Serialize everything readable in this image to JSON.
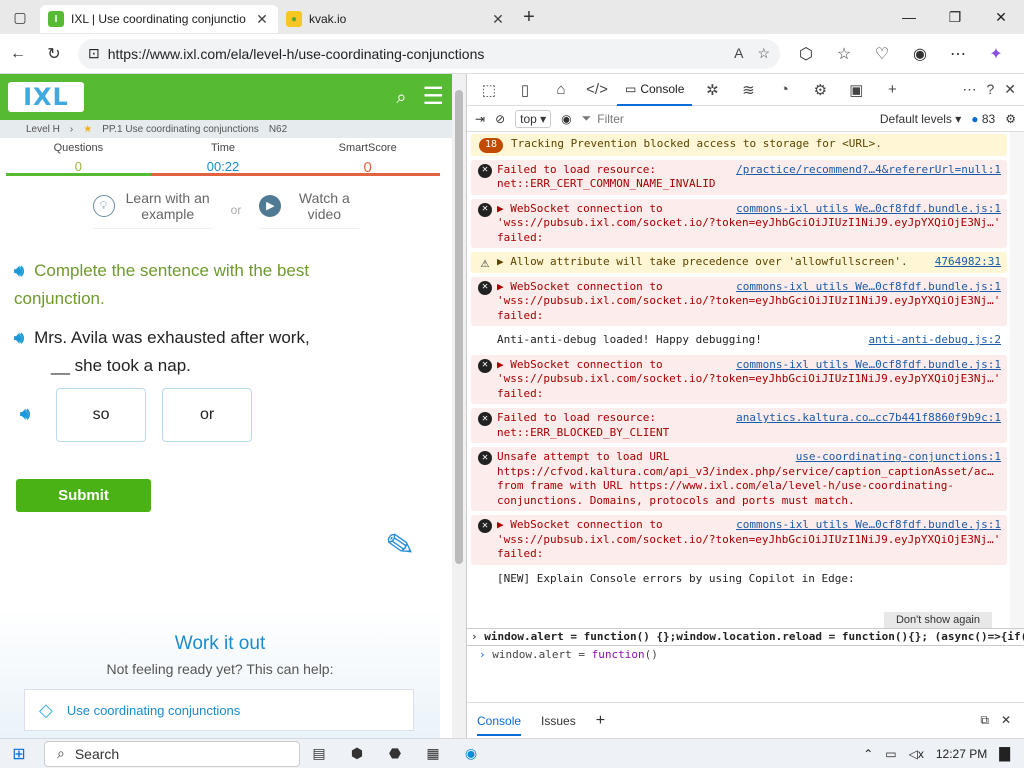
{
  "browser": {
    "tabs": [
      {
        "title": "IXL | Use coordinating conjunctio",
        "favicon": "IXL",
        "active": true
      },
      {
        "title": "kvak.io",
        "favicon": "duck",
        "active": false
      }
    ],
    "url": "https://www.ixl.com/ela/level-h/use-coordinating-conjunctions"
  },
  "ixl": {
    "breadcrumb": {
      "level": "Level H",
      "skill": "PP.1 Use coordinating conjunctions",
      "code": "N62"
    },
    "stats": {
      "questions_label": "Questions",
      "questions_value": "0",
      "time_label": "Time",
      "time_value": "00:22",
      "score_label": "SmartScore",
      "score_value": "0"
    },
    "help": {
      "learn": "Learn with an example",
      "or": "or",
      "watch": "Watch a video"
    },
    "instruction": "Complete the sentence with the best conjunction.",
    "question_line1": "Mrs. Avila was exhausted after work,",
    "question_line2": "__ she took a nap.",
    "answers": [
      "so",
      "or"
    ],
    "submit": "Submit",
    "workout": {
      "title": "Work it out",
      "subtitle": "Not feeling ready yet? This can help:",
      "link": "Use coordinating conjunctions"
    }
  },
  "devtools": {
    "console_tab": "Console",
    "context": "top",
    "filter_placeholder": "Filter",
    "levels": "Default levels",
    "issue_count": "83",
    "messages": [
      {
        "type": "warn-badge",
        "badge": "18",
        "text": "Tracking Prevention blocked access to storage for <URL>."
      },
      {
        "type": "err",
        "text": "Failed to load resource: net::ERR_CERT_COMMON_NAME_INVALID",
        "source": "/practice/recommend?…4&refererUrl=null:1"
      },
      {
        "type": "err",
        "text": "▶ WebSocket connection to 'wss://pubsub.ixl.com/socket.io/?token=eyJhbGciOiJIUzI1NiJ9.eyJpYXQiOjE3Nj…' failed:",
        "source": "commons-ixl utils We…0cf8fdf.bundle.js:1"
      },
      {
        "type": "warn",
        "text": "▶ Allow attribute will take precedence over 'allowfullscreen'.",
        "source": "4764982:31"
      },
      {
        "type": "err",
        "text": "▶ WebSocket connection to 'wss://pubsub.ixl.com/socket.io/?token=eyJhbGciOiJIUzI1NiJ9.eyJpYXQiOjE3Nj…' failed:",
        "source": "commons-ixl utils We…0cf8fdf.bundle.js:1"
      },
      {
        "type": "info",
        "text": "Anti-anti-debug loaded! Happy debugging!",
        "source": "anti-anti-debug.js:2"
      },
      {
        "type": "err",
        "text": "▶ WebSocket connection to 'wss://pubsub.ixl.com/socket.io/?token=eyJhbGciOiJIUzI1NiJ9.eyJpYXQiOjE3Nj…' failed:",
        "source": "commons-ixl utils We…0cf8fdf.bundle.js:1"
      },
      {
        "type": "err",
        "text": "Failed to load resource: net::ERR_BLOCKED_BY_CLIENT",
        "source": "analytics.kaltura.co…cc7b441f8860f9b9c:1"
      },
      {
        "type": "err",
        "text": "Unsafe attempt to load URL https://cfvod.kaltura.com/api_v3/index.php/service/caption_captionAsset/ac… from frame with URL https://www.ixl.com/ela/level-h/use-coordinating-conjunctions. Domains, protocols and ports must match.",
        "source": "use-coordinating-conjunctions:1"
      },
      {
        "type": "err",
        "text": "▶ WebSocket connection to 'wss://pubsub.ixl.com/socket.io/?token=eyJhbGciOiJIUzI1NiJ9.eyJpYXQiOjE3Nj…' failed:",
        "source": "commons-ixl utils We…0cf8fdf.bundle.js:1"
      },
      {
        "type": "info",
        "text": "[NEW] Explain Console errors by using Copilot in Edge:",
        "source": ""
      }
    ],
    "dont_show": "Don't show again",
    "prompt_history": "window.alert = function() {};window.location.reload = function(){}; (async()=>{if(",
    "prompt_current_a": "window.alert = ",
    "prompt_current_kw": "function",
    "prompt_current_b": "()",
    "bottom_tabs": [
      "Console",
      "Issues"
    ]
  },
  "taskbar": {
    "search": "Search",
    "time": "12:27 PM"
  },
  "colors": {
    "ixl_green": "#57ba33",
    "ixl_blue": "#1a8ccf",
    "score_orange": "#e2633f",
    "accent": "#0a6cd6"
  }
}
